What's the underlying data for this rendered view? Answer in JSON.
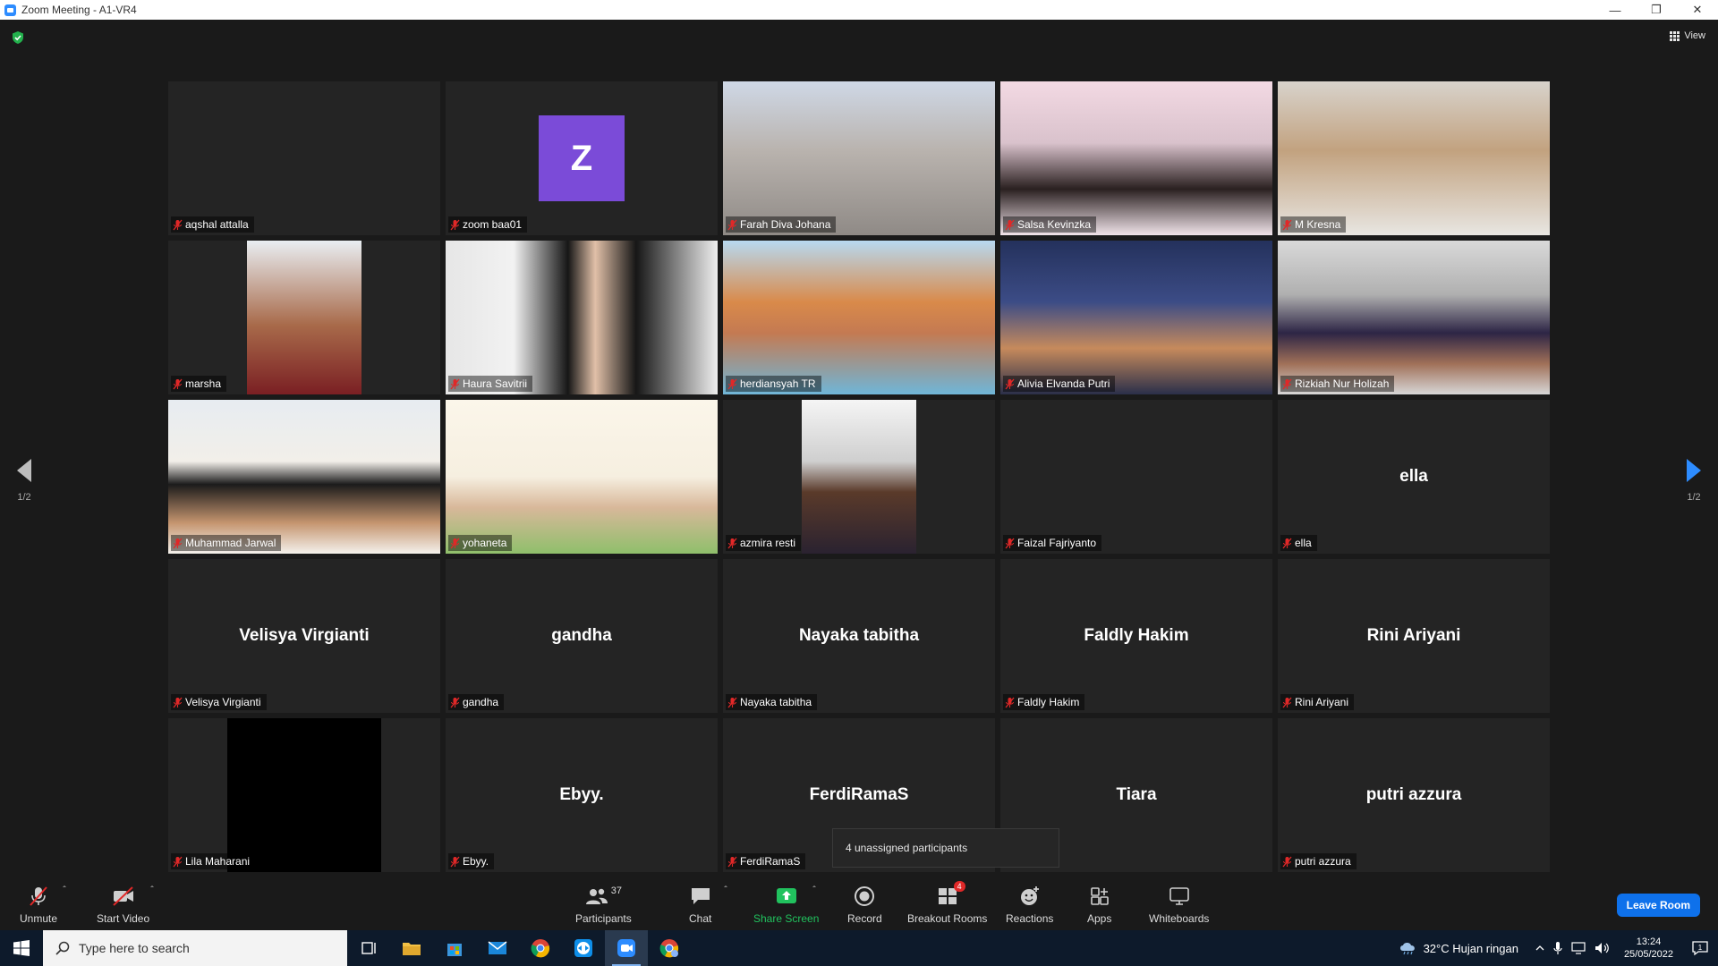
{
  "window": {
    "title": "Zoom Meeting - A1-VR4"
  },
  "header": {
    "view_label": "View"
  },
  "pagination": {
    "left_label": "1/2",
    "right_label": "1/2"
  },
  "participants": [
    {
      "name": "aqshal attalla",
      "type": "blank"
    },
    {
      "name": "zoom baa01",
      "type": "avatar",
      "initial": "Z"
    },
    {
      "name": "Farah Diva Johana",
      "type": "video"
    },
    {
      "name": "Salsa Kevinzka",
      "type": "video"
    },
    {
      "name": "M Kresna",
      "type": "video",
      "active": true
    },
    {
      "name": "marsha",
      "type": "video"
    },
    {
      "name": "Haura Savitrii",
      "type": "video"
    },
    {
      "name": "herdiansyah TR",
      "type": "video"
    },
    {
      "name": "Alivia Elvanda Putri",
      "type": "video"
    },
    {
      "name": "Rizkiah Nur Holizah",
      "type": "video"
    },
    {
      "name": "Muhammad Jarwal",
      "type": "video"
    },
    {
      "name": "yohaneta",
      "type": "video"
    },
    {
      "name": "azmira resti",
      "type": "video"
    },
    {
      "name": "Faizal Fajriyanto",
      "type": "blank"
    },
    {
      "name": "ella",
      "type": "name",
      "display": "ella"
    },
    {
      "name": "Velisya Virgianti",
      "type": "name",
      "display": "Velisya Virgianti"
    },
    {
      "name": "gandha",
      "type": "name",
      "display": "gandha"
    },
    {
      "name": "Nayaka tabitha",
      "type": "name",
      "display": "Nayaka tabitha"
    },
    {
      "name": "Faldly Hakim",
      "type": "name",
      "display": "Faldly Hakim"
    },
    {
      "name": "Rini Ariyani",
      "type": "name",
      "display": "Rini Ariyani"
    },
    {
      "name": "Lila Maharani",
      "type": "video-dark"
    },
    {
      "name": "Ebyy.",
      "type": "name",
      "display": "Ebyy."
    },
    {
      "name": "FerdiRamaS",
      "type": "name",
      "display": "FerdiRamaS"
    },
    {
      "name": "Tiara",
      "type": "name-only",
      "display": "Tiara"
    },
    {
      "name": "putri azzura",
      "type": "name",
      "display": "putri azzura"
    }
  ],
  "popup": {
    "text": "4 unassigned participants"
  },
  "toolbar": {
    "unmute": "Unmute",
    "start_video": "Start Video",
    "participants": "Participants",
    "participants_count": "37",
    "chat": "Chat",
    "share_screen": "Share Screen",
    "record": "Record",
    "breakout_rooms": "Breakout Rooms",
    "breakout_badge": "4",
    "reactions": "Reactions",
    "apps": "Apps",
    "whiteboards": "Whiteboards",
    "leave": "Leave Room"
  },
  "taskbar": {
    "search_placeholder": "Type here to search",
    "weather": "32°C  Hujan ringan",
    "time": "13:24",
    "date": "25/05/2022",
    "notification_count": "1"
  },
  "colors": {
    "accent_blue": "#0e71eb",
    "share_green": "#21c25e",
    "active_speaker": "#f0f04a",
    "avatar_purple": "#7b4bd8",
    "mic_muted_red": "#e02828"
  }
}
